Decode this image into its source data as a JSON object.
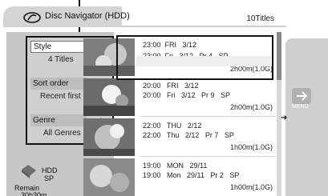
{
  "header": {
    "title": "Disc Navigator (HDD)",
    "title_count": "10Titles"
  },
  "menu": {
    "items": [
      {
        "label": "Style",
        "value": "4 Titles"
      },
      {
        "label": "Sort order",
        "value": "Recent first"
      },
      {
        "label": "Genre",
        "value": "All Genres"
      }
    ]
  },
  "storage": {
    "source": "HDD",
    "mode": "SP",
    "remain_label": "Remain",
    "remain_value": "30h30m"
  },
  "recordings": [
    {
      "line1": "23:00  FRI   3/12",
      "line2": "23:00  Fri   3/12   Pr 4   SP",
      "duration": "2h00m(1.0G)"
    },
    {
      "line1": "20:00   FRI   3/12",
      "line2": "20:00   Fri   3/12   Pr 9   SP",
      "duration": "2h00m(1.0G)"
    },
    {
      "line1": "22:00   THU   2/12",
      "line2": "22:00   Thu   2/12   Pr 7   SP",
      "duration": "1h00m(1.0G)"
    },
    {
      "line1": "19:00   MON   29/11",
      "line2": "19:00   Mon   29/11   Pr 2   SP",
      "duration": "1h00m(1.0G)"
    }
  ],
  "right_menu_label": "MENU"
}
